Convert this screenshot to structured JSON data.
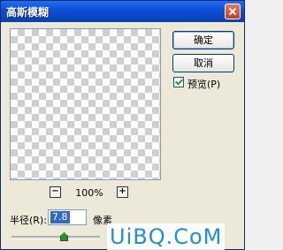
{
  "window": {
    "title": "高斯模糊"
  },
  "buttons": {
    "ok": "确定",
    "cancel": "取消"
  },
  "preview_checkbox": {
    "label": "预览(P)",
    "checked": true
  },
  "zoom": {
    "minus": "−",
    "plus": "+",
    "level": "100%"
  },
  "radius": {
    "label": "半径(R):",
    "value": "7.8",
    "unit": "像素"
  },
  "watermark": {
    "text": "UiBQ.CoM"
  }
}
